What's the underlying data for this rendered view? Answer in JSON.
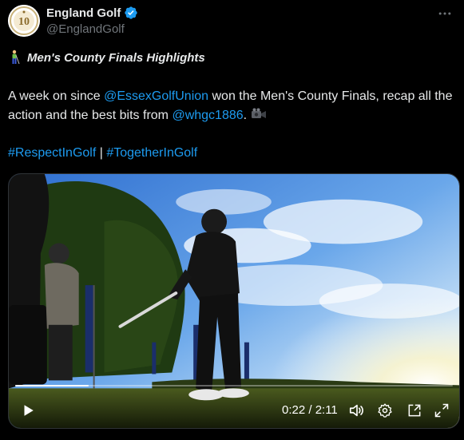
{
  "author": {
    "display_name": "England Golf",
    "handle": "@EnglandGolf",
    "verified_color": "#1d9bf0"
  },
  "tweet": {
    "title": "Men's County Finals Highlights",
    "body_part1": "A week on since ",
    "mention1": "@EssexGolfUnion",
    "body_part2": " won the Men's County Finals, recap all the action and the best bits from ",
    "mention2": "@whgc1886",
    "body_part3": ". ",
    "hashtag1": "#RespectInGolf",
    "separator": " | ",
    "hashtag2": "#TogetherInGolf"
  },
  "video": {
    "current_time": "0:22",
    "duration": "2:11",
    "time_display": "0:22 / 2:11",
    "progress_fraction": 0.168
  },
  "icons": {
    "more": "more-icon",
    "verified": "verified-badge-icon",
    "play": "play-icon",
    "volume": "volume-icon",
    "settings": "settings-icon",
    "pip": "picture-in-picture-icon",
    "fullscreen": "fullscreen-icon",
    "golfer": "golfer-emoji-icon",
    "camera": "video-camera-emoji-icon"
  },
  "colors": {
    "background": "#000000",
    "text": "#e7e9ea",
    "secondary_text": "#71767b",
    "link": "#1d9bf0"
  }
}
